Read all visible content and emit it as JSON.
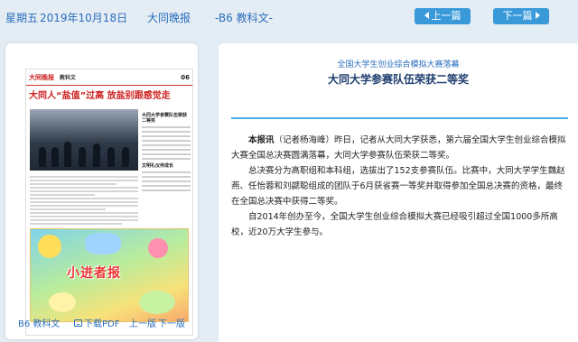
{
  "topbar": {
    "weekday": "星期五",
    "date": "2019年10月18日",
    "paper": "大同晚报",
    "page": "-B6 教科文-",
    "prev_label": "上一篇",
    "next_label": "下一篇",
    "accent_color": "#3a9ad9"
  },
  "thumbnail": {
    "logo": "大同晚报",
    "section": "教科文",
    "page_no": "06",
    "headline": "大同人“盐值”过高  放盐别跟感觉走",
    "side_head_1": "大同大学参赛队伍荣获二等奖",
    "side_head_2": "文明礼仪伴成长",
    "ad_title": "小进者报"
  },
  "footer": {
    "page_label": "B6 教科文",
    "download_label": "下载PDF",
    "prev_page": "上一版",
    "next_page": "下一版"
  },
  "article": {
    "subtitle": "全国大学生创业综合模拟大赛落幕",
    "title": "大同大学参赛队伍荣获二等奖",
    "lead": "本报讯",
    "para1": "（记者杨海峰）昨日，记者从大同大学获悉，第六届全国大学生创业综合模拟大赛全国总决赛圆满落幕，大同大学参赛队伍荣获二等奖。",
    "para2": "总决赛分为高职组和本科组，选拔出了152支参赛队伍。比赛中，大同大学学生魏赵燕、任怡蓉和刘勰聪组成的团队于6月获省赛一等奖并取得参加全国总决赛的资格，最终在全国总决赛中获得二等奖。",
    "para3": "自2014年创办至今，全国大学生创业综合模拟大赛已经吸引超过全国1000多所高校，近20万大学生参与。"
  }
}
